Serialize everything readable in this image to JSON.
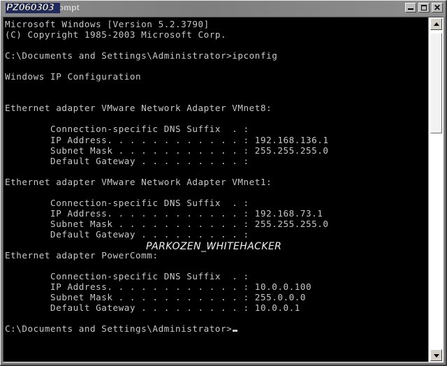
{
  "window": {
    "title": "Command Prompt",
    "title_watermark": "PZ060303",
    "body_watermark": "PARKOZEN_WHITEHACKER",
    "buttons": {
      "minimize": "Minimize",
      "maximize": "Maximize",
      "close": "Close"
    }
  },
  "console": {
    "text": "Microsoft Windows [Version 5.2.3790]\n(C) Copyright 1985-2003 Microsoft Corp.\n\nC:\\Documents and Settings\\Administrator>ipconfig\n\nWindows IP Configuration\n\n\nEthernet adapter VMware Network Adapter VMnet8:\n\n        Connection-specific DNS Suffix  . :\n        IP Address. . . . . . . . . . . . : 192.168.136.1\n        Subnet Mask . . . . . . . . . . . : 255.255.255.0\n        Default Gateway . . . . . . . . . :\n\nEthernet adapter VMware Network Adapter VMnet1:\n\n        Connection-specific DNS Suffix  . :\n        IP Address. . . . . . . . . . . . : 192.168.73.1\n        Subnet Mask . . . . . . . . . . . : 255.255.255.0\n        Default Gateway . . . . . . . . . :\n\nEthernet adapter PowerComm:\n\n        Connection-specific DNS Suffix  . :\n        IP Address. . . . . . . . . . . . : 10.0.0.100\n        Subnet Mask . . . . . . . . . . . : 255.0.0.0\n        Default Gateway . . . . . . . . . : 10.0.0.1\n\nC:\\Documents and Settings\\Administrator>",
    "lines": [
      "Microsoft Windows [Version 5.2.3790]",
      "(C) Copyright 1985-2003 Microsoft Corp.",
      "",
      "C:\\Documents and Settings\\Administrator>ipconfig",
      "",
      "Windows IP Configuration",
      "",
      "",
      "Ethernet adapter VMware Network Adapter VMnet8:",
      "",
      "        Connection-specific DNS Suffix  . :",
      "        IP Address. . . . . . . . . . . . : 192.168.136.1",
      "        Subnet Mask . . . . . . . . . . . : 255.255.255.0",
      "        Default Gateway . . . . . . . . . :",
      "",
      "Ethernet adapter VMware Network Adapter VMnet1:",
      "",
      "        Connection-specific DNS Suffix  . :",
      "        IP Address. . . . . . . . . . . . : 192.168.73.1",
      "        Subnet Mask . . . . . . . . . . . : 255.255.255.0",
      "        Default Gateway . . . . . . . . . :",
      "",
      "Ethernet adapter PowerComm:",
      "",
      "        Connection-specific DNS Suffix  . :",
      "        IP Address. . . . . . . . . . . . : 10.0.0.100",
      "        Subnet Mask . . . . . . . . . . . : 255.0.0.0",
      "        Default Gateway . . . . . . . . . : 10.0.0.1",
      "",
      "C:\\Documents and Settings\\Administrator>"
    ],
    "banner": {
      "os": "Microsoft Windows [Version 5.2.3790]",
      "copyright": "(C) Copyright 1985-2003 Microsoft Corp."
    },
    "command": "ipconfig",
    "prompt": "C:\\Documents and Settings\\Administrator>",
    "section_title": "Windows IP Configuration",
    "adapters": [
      {
        "header": "Ethernet adapter VMware Network Adapter VMnet8:",
        "dns_suffix_label": "Connection-specific DNS Suffix  . :",
        "dns_suffix": "",
        "ip_label": "IP Address. . . . . . . . . . . . :",
        "ip_address": "192.168.136.1",
        "mask_label": "Subnet Mask . . . . . . . . . . . :",
        "subnet_mask": "255.255.255.0",
        "gateway_label": "Default Gateway . . . . . . . . . :",
        "default_gateway": ""
      },
      {
        "header": "Ethernet adapter VMware Network Adapter VMnet1:",
        "dns_suffix_label": "Connection-specific DNS Suffix  . :",
        "dns_suffix": "",
        "ip_label": "IP Address. . . . . . . . . . . . :",
        "ip_address": "192.168.73.1",
        "mask_label": "Subnet Mask . . . . . . . . . . . :",
        "subnet_mask": "255.255.255.0",
        "gateway_label": "Default Gateway . . . . . . . . . :",
        "default_gateway": ""
      },
      {
        "header": "Ethernet adapter PowerComm:",
        "dns_suffix_label": "Connection-specific DNS Suffix  . :",
        "dns_suffix": "",
        "ip_label": "IP Address. . . . . . . . . . . . :",
        "ip_address": "10.0.0.100",
        "mask_label": "Subnet Mask . . . . . . . . . . . :",
        "subnet_mask": "255.0.0.0",
        "gateway_label": "Default Gateway . . . . . . . . . :",
        "default_gateway": "10.0.0.1"
      }
    ]
  },
  "scrollbar": {
    "up_arrow": "scroll-up",
    "down_arrow": "scroll-down"
  },
  "colors": {
    "console_bg": "#000000",
    "console_fg": "#c8c8c8",
    "titlebar": "#808080",
    "watermark_highlight": "#202a5e"
  }
}
